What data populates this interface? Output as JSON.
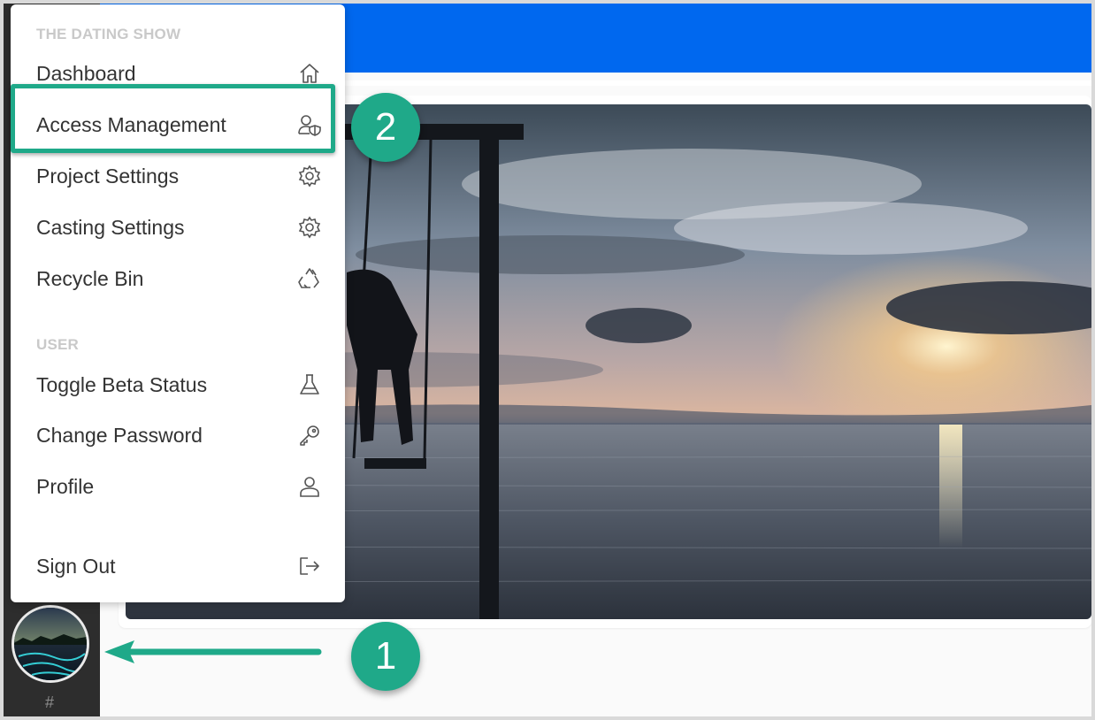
{
  "menu": {
    "section_project": "THE DATING SHOW",
    "section_user": "USER",
    "items": [
      {
        "label": "Dashboard",
        "icon": "home-icon"
      },
      {
        "label": "Access Management",
        "icon": "user-shield-icon"
      },
      {
        "label": "Project Settings",
        "icon": "gear-icon"
      },
      {
        "label": "Casting Settings",
        "icon": "gear-icon"
      },
      {
        "label": "Recycle Bin",
        "icon": "recycle-icon"
      },
      {
        "label": "Toggle Beta Status",
        "icon": "flask-icon"
      },
      {
        "label": "Change Password",
        "icon": "key-icon"
      },
      {
        "label": "Profile",
        "icon": "user-icon"
      },
      {
        "label": "Sign Out",
        "icon": "sign-out-icon"
      }
    ]
  },
  "sidebar": {
    "footer_text": "#"
  },
  "callouts": [
    {
      "number": "1"
    },
    {
      "number": "2"
    }
  ],
  "colors": {
    "topbar": "#0068ef",
    "callout": "#1fa989",
    "sidebar": "#2d2d2d"
  }
}
